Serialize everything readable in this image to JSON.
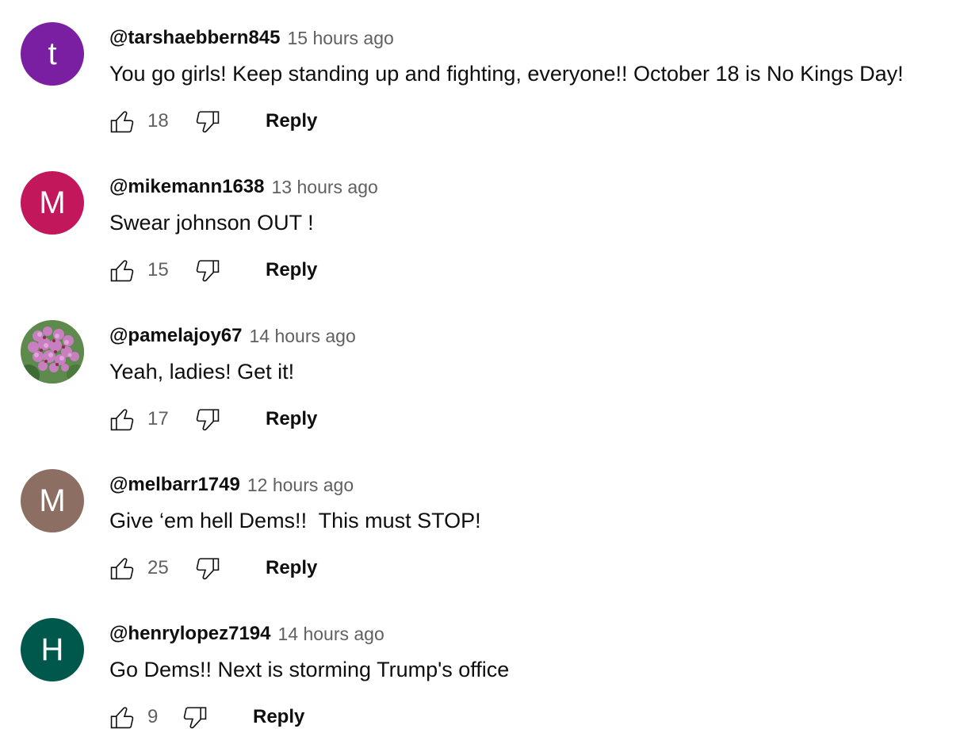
{
  "comments": [
    {
      "avatar": {
        "type": "letter",
        "letter": "t",
        "color": "#7b1fa2"
      },
      "author": "@tarshaebbern845",
      "time": "15 hours ago",
      "text": "You go girls! Keep standing up and fighting, everyone!! October 18 is No Kings Day!",
      "likes": "18",
      "reply_label": "Reply"
    },
    {
      "avatar": {
        "type": "letter",
        "letter": "M",
        "color": "#c2185b"
      },
      "author": "@mikemann1638",
      "time": "13 hours ago",
      "text": "Swear johnson OUT !",
      "likes": "15",
      "reply_label": "Reply"
    },
    {
      "avatar": {
        "type": "image",
        "icon": "pink-flowers-photo"
      },
      "author": "@pamelajoy67",
      "time": "14 hours ago",
      "text": "Yeah, ladies! Get it!",
      "likes": "17",
      "reply_label": "Reply"
    },
    {
      "avatar": {
        "type": "letter",
        "letter": "M",
        "color": "#8d6e63"
      },
      "author": "@melbarr1749",
      "time": "12 hours ago",
      "text": "Give ‘em hell Dems!!  This must STOP!",
      "likes": "25",
      "reply_label": "Reply"
    },
    {
      "avatar": {
        "type": "letter",
        "letter": "H",
        "color": "#00574b"
      },
      "author": "@henrylopez7194",
      "time": "14 hours ago",
      "text": "Go Dems!! Next is storming Trump's office",
      "likes": "9",
      "reply_label": "Reply"
    }
  ],
  "icons": {
    "like": "thumbs-up-icon",
    "dislike": "thumbs-down-icon"
  }
}
